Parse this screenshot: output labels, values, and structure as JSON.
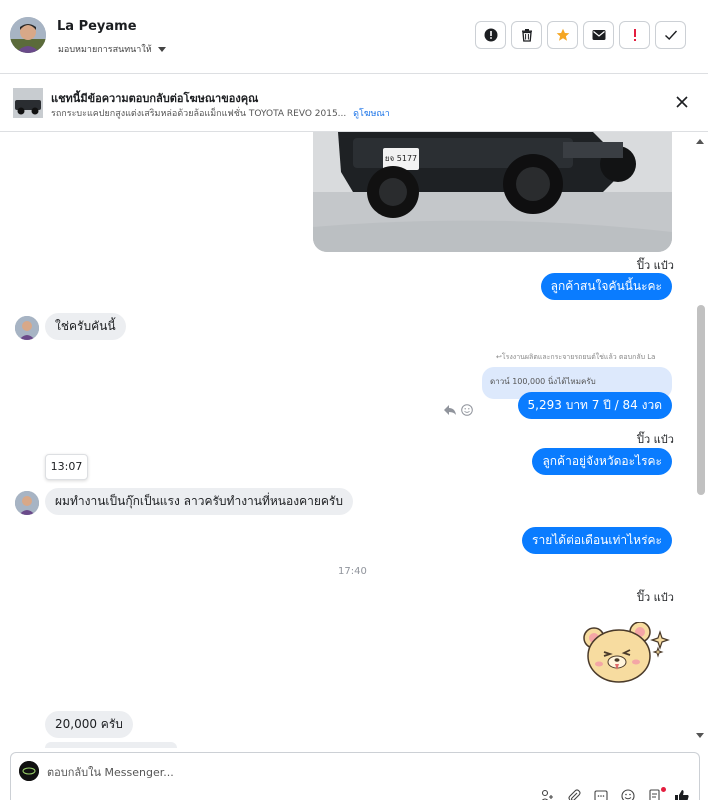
{
  "header": {
    "contact_name": "La Peyame",
    "assign_label": "มอบหมายการสนทนาให้",
    "actions": [
      {
        "name": "report-spam-button",
        "icon": "alert-circle-icon"
      },
      {
        "name": "delete-button",
        "icon": "trash-icon"
      },
      {
        "name": "star-button",
        "icon": "star-icon",
        "color": "#f5a623"
      },
      {
        "name": "mark-unread-button",
        "icon": "envelope-icon"
      },
      {
        "name": "follow-up-button",
        "icon": "exclamation-icon",
        "color": "#e41e3f"
      },
      {
        "name": "mark-done-button",
        "icon": "check-icon"
      }
    ]
  },
  "ad_banner": {
    "title": "แชทนี้มีข้อความตอบกลับต่อโฆษณาของคุณ",
    "subtitle": "รถกระบะแคปยกสูงแต่งเสริมหล่อด้วยล้อแม็กแฟชั่น TOYOTA REVO 2015...",
    "link": "ดูโฆษณา"
  },
  "messages": {
    "sender_label_1": "ปิ๊ว แป๋ว",
    "out_1": "ลูกค้าสนใจคันนี้นะคะ",
    "in_1": "ใช่ครับคันนี้",
    "replied_note": "↩โรงงานผลิตและกระจายรถยนต์ใช่แล้ว ตอบกลับ La",
    "quote_text": "ดาวน์ 100,000 นิ่งได้ไหมครับ",
    "out_2": "5,293 บาท  7 ปี / 84 งวด",
    "sender_label_2": "ปิ๊ว แป๋ว",
    "out_3": "ลูกค้าอยู่จังหวัดอะไรคะ",
    "time_chip": "13:07",
    "in_2": "ผมทำงานเป็นกุ๊กเป็นแรง ลาวครับทำงานที่หนองคายครับ",
    "out_4": "รายได้ต่อเดือนเท่าไหร่คะ",
    "time_divider": "17:40",
    "sender_label_3": "ปิ๊ว แป๋ว",
    "in_3": "20,000 ครับ"
  },
  "composer": {
    "placeholder": "ตอบกลับใน Messenger..."
  },
  "colors": {
    "accent": "#0a7cff",
    "incoming_bubble": "#eceef1",
    "quote_bg": "#dde9fc"
  }
}
